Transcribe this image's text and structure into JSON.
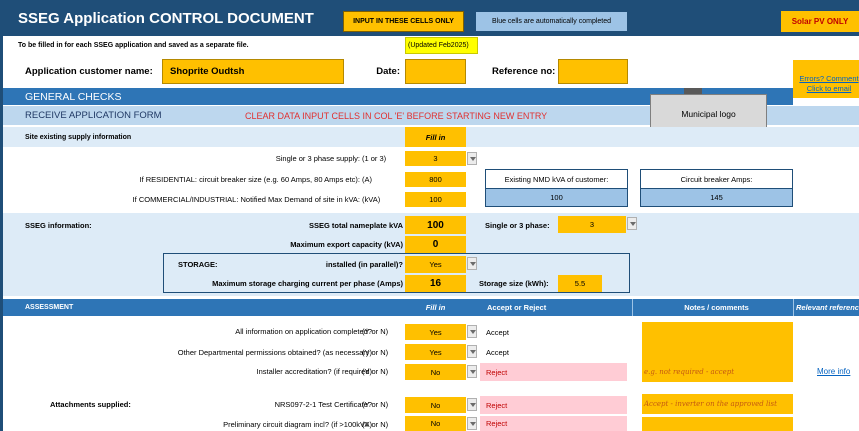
{
  "header": {
    "title": "SSEG Application CONTROL DOCUMENT",
    "input_note": "INPUT IN THESE CELLS ONLY",
    "blue_note": "Blue cells are automatically completed",
    "solar_note": "Solar PV ONLY",
    "fill_note": "To be filled in for each SSEG application and saved as a separate file.",
    "updated": "(Updated Feb2025)"
  },
  "customer": {
    "name_label": "Application customer name:",
    "name_value": "Shoprite Oudtsh",
    "date_label": "Date:",
    "date_value": "",
    "ref_label": "Reference no:",
    "ref_value": "",
    "errors_line1": "Errors? Comment",
    "errors_line2": "Click to email"
  },
  "general": {
    "heading": "GENERAL CHECKS",
    "receive_label": "RECEIVE APPLICATION FORM",
    "clear_warning": "CLEAR DATA INPUT CELLS IN COL 'E' BEFORE STARTING NEW ENTRY",
    "municipal_logo": "Municipal logo",
    "site_supply": "Site existing supply information",
    "fill_in": "Fill in"
  },
  "supply_rows": [
    {
      "label": "Single or 3 phase supply:",
      "unit": "(1 or 3)",
      "value": "3"
    },
    {
      "label": "If RESIDENTIAL: circuit breaker size (e.g. 60 Amps, 80 Amps etc):",
      "unit": "(A)",
      "value": "800"
    },
    {
      "label": "If COMMERCIAL/INDUSTRIAL: Notified Max Demand of site in kVA:",
      "unit": "(kVA)",
      "value": "100"
    }
  ],
  "nmd": {
    "label": "Existing NMD kVA of customer:",
    "value": "100",
    "cb_label": "Circuit breaker Amps:",
    "cb_value": "145"
  },
  "sseg": {
    "heading": "SSEG information:",
    "nameplate_label": "SSEG total nameplate kVA",
    "nameplate_value": "100",
    "phase_label": "Single or 3 phase:",
    "phase_value": "3",
    "export_label": "Maximum export capacity (kVA)",
    "export_value": "0",
    "storage_label": "STORAGE:",
    "installed_label": "installed (in parallel)?",
    "installed_value": "Yes",
    "charging_label": "Maximum storage charging current per phase (Amps)",
    "charging_value": "16",
    "storage_size_label": "Storage size (kWh):",
    "storage_size_value": "5.5"
  },
  "assessment": {
    "heading": "ASSESSMENT",
    "col_fill_in": "Fill in",
    "col_accept": "Accept or Reject",
    "col_notes": "Notes / comments",
    "col_reference": "Relevant reference",
    "attachments_label": "Attachments supplied:",
    "more_info": "More info",
    "rows": [
      {
        "label": "All information on application completed?",
        "unit": "(Y or N)",
        "value": "Yes",
        "result": "Accept",
        "note": ""
      },
      {
        "label": "Other Departmental permissions obtained? (as necessary)",
        "unit": "(Y or N)",
        "value": "Yes",
        "result": "Accept",
        "note": ""
      },
      {
        "label": "Installer accreditation? (if required)",
        "unit": "(Y or N)",
        "value": "No",
        "result": "Reject",
        "note": "e.g. not required - accept"
      },
      {
        "label": "NRS097-2-1 Test Certificate?",
        "unit": "(Y or N)",
        "value": "No",
        "result": "Reject",
        "note": "Accept - inverter on the approved list"
      },
      {
        "label": "Preliminary circuit diagram incl? (if >100kVA)",
        "unit": "(Y or N)",
        "value": "No",
        "result": "Reject",
        "note": ""
      }
    ]
  },
  "colors": {
    "navy": "#1f4e78",
    "orange": "#ffc000",
    "light_blue": "#ddebf7",
    "blue_cell": "#9dc3e6",
    "pink": "#ffccd5",
    "red": "#c00000"
  }
}
